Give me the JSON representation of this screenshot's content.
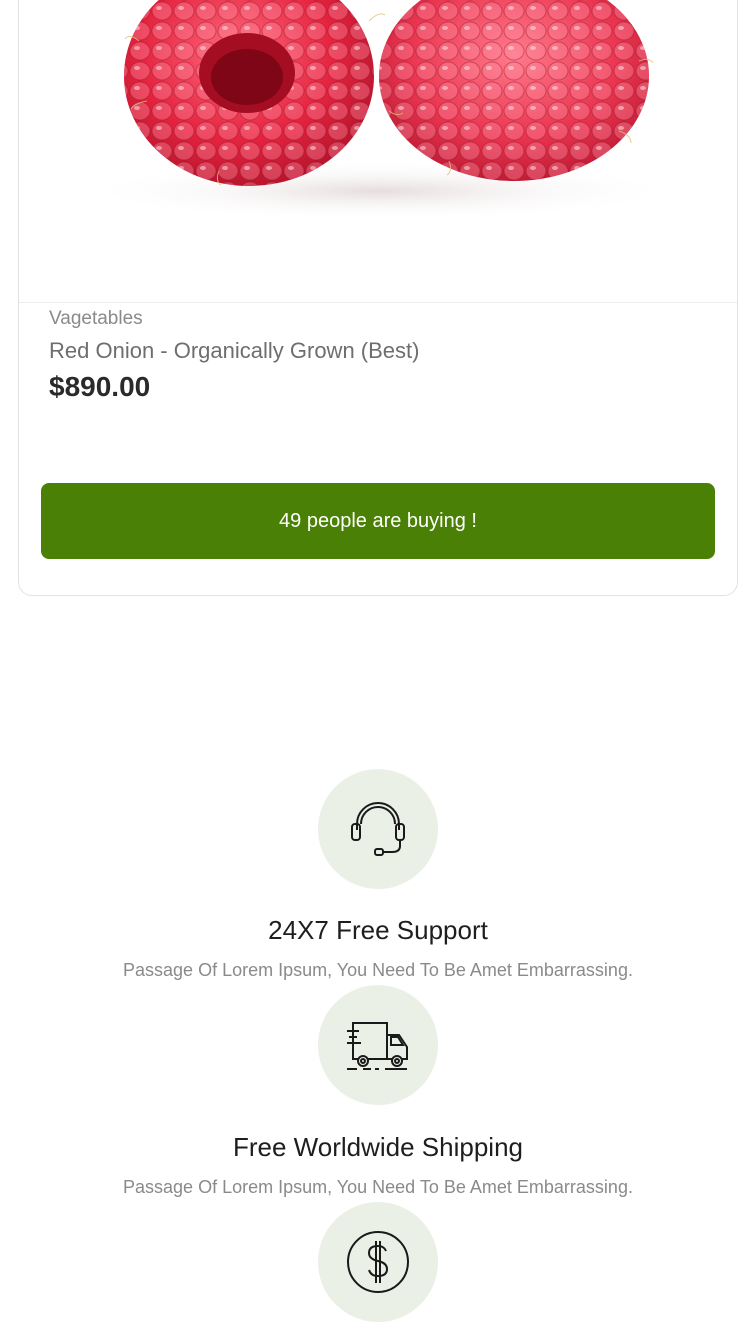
{
  "product": {
    "category": "Vagetables",
    "name": "Red Onion - Organically Grown (Best)",
    "price": "$890.00",
    "buying_label": "49 people are buying !",
    "button_color": "#4a8005"
  },
  "features": [
    {
      "icon": "headset-icon",
      "title": "24X7 Free Support",
      "description": "Passage Of Lorem Ipsum, You Need To Be Amet Embarrassing."
    },
    {
      "icon": "delivery-truck-icon",
      "title": "Free Worldwide Shipping",
      "description": "Passage Of Lorem Ipsum, You Need To Be Amet Embarrassing."
    },
    {
      "icon": "dollar-coin-icon"
    }
  ],
  "colors": {
    "icon_circle_bg": "#ebf0e6",
    "accent_green": "#4a8005"
  }
}
